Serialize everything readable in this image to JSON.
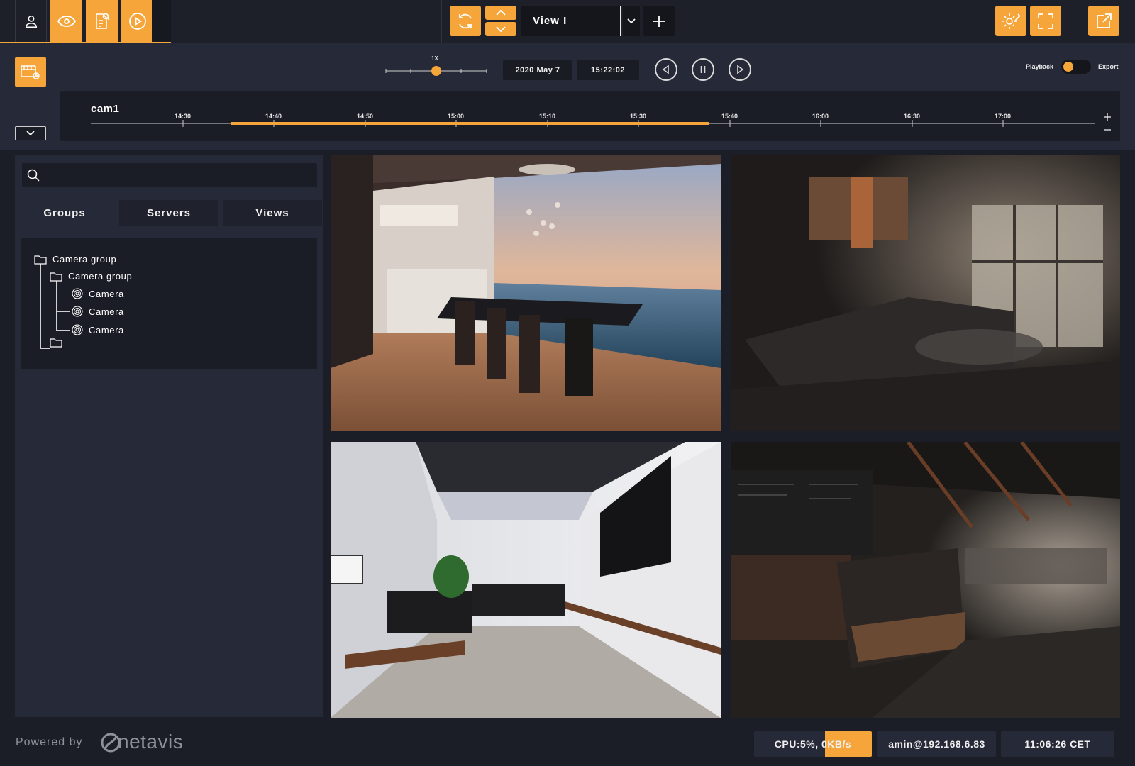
{
  "colors": {
    "accent": "#f6a53b",
    "background": "#1c1e27",
    "panel": "#262937",
    "dark": "#1b1d26"
  },
  "topbar": {
    "view_select": {
      "value": "View I"
    },
    "icons": [
      "user-icon",
      "eye-icon",
      "report-icon",
      "play-circle-icon",
      "refresh-icon",
      "chevron-up-icon",
      "chevron-down-icon",
      "plus-icon",
      "settings-icon",
      "fullscreen-icon",
      "external-link-icon"
    ]
  },
  "playback": {
    "speed_label": "1X",
    "speed_fraction": 0.5,
    "date": "2020 May 7",
    "time": "15:22:02",
    "mode_left": "Playback",
    "mode_right": "Export",
    "mode_state": "Playback"
  },
  "timeline": {
    "camera": "cam1",
    "ticks": [
      "14:30",
      "14:40",
      "14:50",
      "15:00",
      "15:10",
      "15:30",
      "15:40",
      "16:00",
      "16:30",
      "17:00"
    ],
    "recorded_range": [
      "14:35",
      "15:48"
    ]
  },
  "sidebar": {
    "search": {
      "value": "",
      "placeholder": ""
    },
    "tabs": [
      {
        "label": "Groups",
        "active": true
      },
      {
        "label": "Servers",
        "active": false
      },
      {
        "label": "Views",
        "active": false
      }
    ],
    "tree": {
      "root": "Camera group",
      "child": "Camera group",
      "cameras": [
        "Camera",
        "Camera",
        "Camera"
      ],
      "empty_folder": ""
    }
  },
  "footer": {
    "powered_by": "Powered by",
    "brand": "netavis",
    "cpu": "CPU:5%, 0KB/s",
    "user": "amin@192.168.6.83",
    "clock": "11:06:26 CET"
  }
}
